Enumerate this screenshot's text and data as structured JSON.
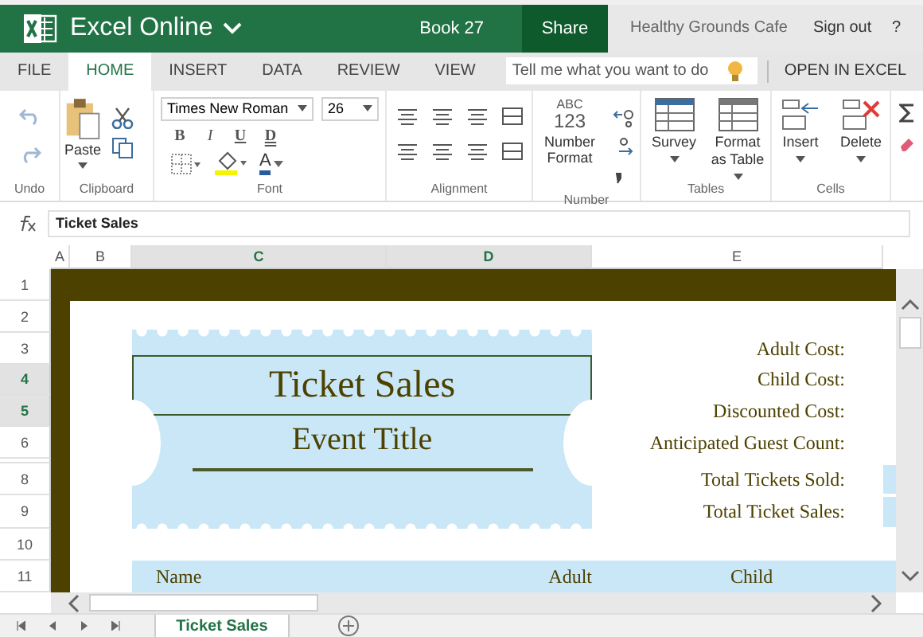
{
  "top_bar": {
    "app_name": "Excel Online",
    "book": "Book 27",
    "share": "Share",
    "user": "Healthy Grounds Cafe",
    "sign_out": "Sign out",
    "help": "?"
  },
  "tabs": [
    {
      "label": "FILE",
      "selected": false
    },
    {
      "label": "HOME",
      "selected": true
    },
    {
      "label": "INSERT",
      "selected": false
    },
    {
      "label": "DATA",
      "selected": false
    },
    {
      "label": "REVIEW",
      "selected": false
    },
    {
      "label": "VIEW",
      "selected": false
    }
  ],
  "tell_me": {
    "placeholder": "Tell me what you want to do"
  },
  "open_in_excel": "OPEN IN EXCEL",
  "ribbon": {
    "group_labels": [
      "Undo",
      "Clipboard",
      "Font",
      "Alignment",
      "Number",
      "Tables",
      "Cells"
    ],
    "paste": "Paste",
    "font_name": "Times New Roman",
    "font_size": "26",
    "font_buttons": [
      "B",
      "I",
      "U",
      "D"
    ],
    "font_color": "A",
    "number_icon": [
      "ABC",
      "123"
    ],
    "number_format": "Number Format",
    "table_buttons": [
      "Survey",
      "Format as Table"
    ],
    "cell_buttons": [
      "Insert",
      "Delete"
    ]
  },
  "formula_bar": {
    "value": "Ticket Sales"
  },
  "columns": [
    {
      "label": "A",
      "selected": false
    },
    {
      "label": "B",
      "selected": false
    },
    {
      "label": "C",
      "selected": true
    },
    {
      "label": "D",
      "selected": true
    },
    {
      "label": "E",
      "selected": false
    }
  ],
  "rows": [
    {
      "label": "1",
      "selected": false
    },
    {
      "label": "2",
      "selected": false
    },
    {
      "label": "3",
      "selected": false
    },
    {
      "label": "4",
      "selected": true
    },
    {
      "label": "5",
      "selected": true
    },
    {
      "label": "6",
      "selected": false
    },
    {
      "selected": false
    },
    {
      "label": "8",
      "selected": false
    },
    {
      "label": "9",
      "selected": false
    },
    {
      "label": "10",
      "selected": false
    },
    {
      "label": "11",
      "selected": false
    }
  ],
  "ticket": {
    "title": "Ticket Sales",
    "event": "Event Title"
  },
  "cost_labels": [
    "Adult Cost:",
    "Child Cost:",
    "Discounted Cost:",
    "Anticipated Guest Count:"
  ],
  "total_labels": [
    "Total Tickets Sold:",
    "Total Ticket Sales:"
  ],
  "table_headers": [
    "Name",
    "Adult",
    "Child"
  ],
  "sheet_tabs": [
    {
      "label": "Ticket Sales",
      "selected": true
    }
  ]
}
